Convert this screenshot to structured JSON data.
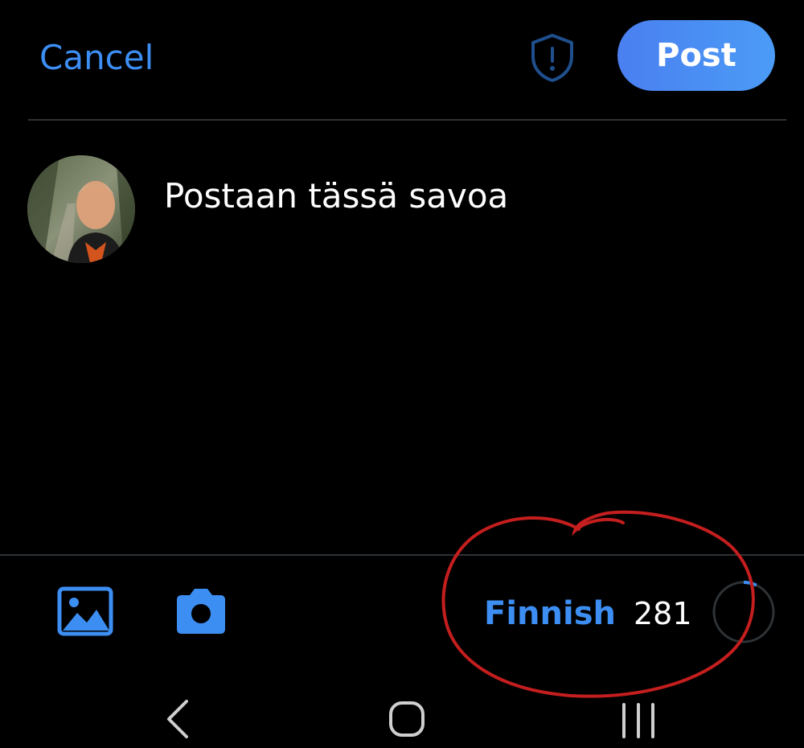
{
  "header": {
    "cancel_label": "Cancel",
    "post_label": "Post",
    "shield_icon": "shield-alert-icon"
  },
  "composer": {
    "text": "Postaan tässä savoa",
    "avatar_icon": "user-avatar"
  },
  "toolbar": {
    "image_icon": "image-icon",
    "camera_icon": "camera-icon",
    "language": "Finnish",
    "chars_remaining": "281",
    "progress": 0.07
  },
  "nav": {
    "back_icon": "back-icon",
    "home_icon": "home-icon",
    "recents_icon": "recents-icon"
  },
  "colors": {
    "accent": "#3d8ef3",
    "background": "#000000",
    "divider": "#2f3336",
    "annotation": "#c41e1e"
  }
}
